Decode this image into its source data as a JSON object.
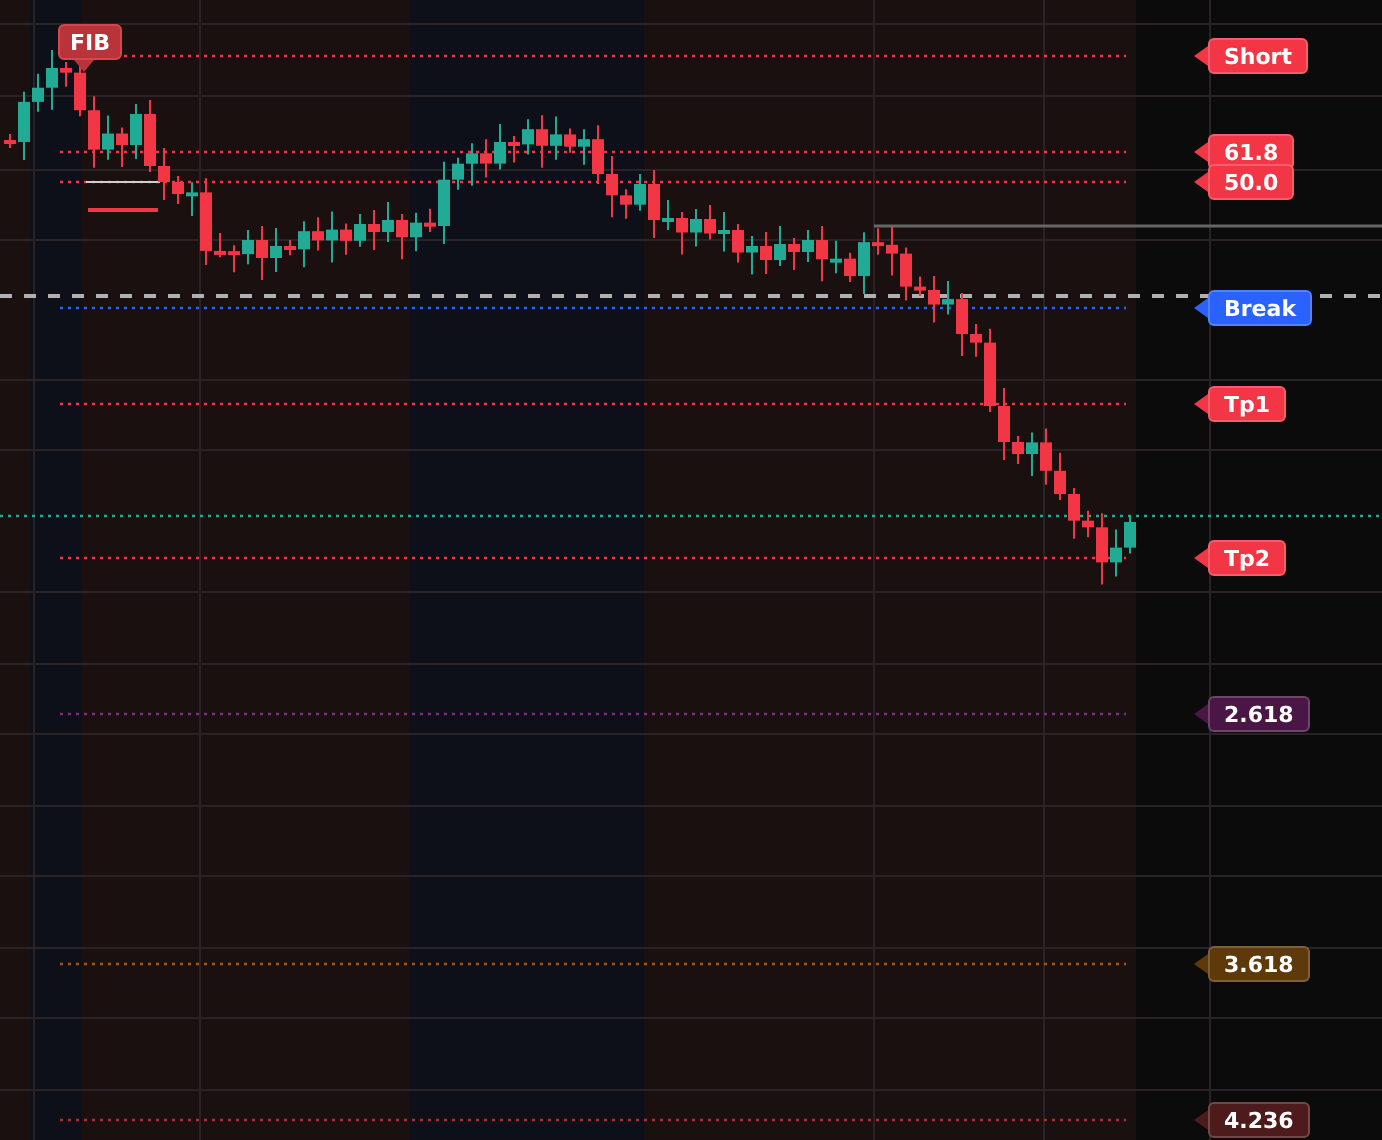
{
  "fib_tag": {
    "label": "FIB"
  },
  "levels": [
    {
      "label": "Short",
      "color": "#f23645"
    },
    {
      "label": "61.8",
      "color": "#f23645"
    },
    {
      "label": "50.0",
      "color": "#f23645"
    },
    {
      "label": "Break",
      "color": "#2962ff"
    },
    {
      "label": "Tp1",
      "color": "#f23645"
    },
    {
      "label": "Tp2",
      "color": "#f23645"
    },
    {
      "label": "2.618",
      "color": "#4a1645"
    },
    {
      "label": "3.618",
      "color": "#5e3a0a"
    },
    {
      "label": "4.236",
      "color": "#4d1b1b"
    }
  ]
}
